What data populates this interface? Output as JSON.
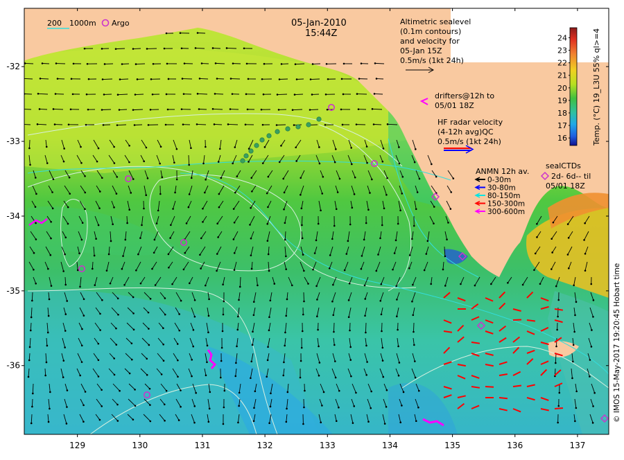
{
  "map": {
    "date": "05-Jan-2010",
    "time": "15:44Z",
    "scale_labels": [
      "200",
      "1000m"
    ],
    "argo_label": "Argo",
    "altimetric_lines": [
      "Altimetric sealevel",
      "(0.1m contours)",
      "and velocity for",
      "05-Jan 15Z",
      "0.5m/s (1kt 24h)"
    ],
    "drifters_lines": [
      "drifters@12h to",
      "05/01 18Z"
    ],
    "hf_lines": [
      "HF radar velocity",
      "(4-12h avg)QC",
      "0.5m/s (1kt 24h)"
    ],
    "anmn_title": "ANMN 12h av.",
    "anmn_items": [
      {
        "label": "0-30m",
        "color": "#000000"
      },
      {
        "label": "30-80m",
        "color": "#0000ff"
      },
      {
        "label": "80-150m",
        "color": "#00e5e5"
      },
      {
        "label": "150-300m",
        "color": "#ff0000"
      },
      {
        "label": "300-600m",
        "color": "#ff00ff"
      }
    ],
    "seal_lines": [
      "sealCTDs",
      "2d- 6d-- til",
      "05/01 18Z"
    ],
    "colorbar": {
      "label": "Temp. (°C) 19_L3U 55% ql>=4",
      "ticks": [
        16,
        17,
        18,
        19,
        20,
        21,
        22,
        23,
        24
      ],
      "range": [
        15.4,
        24.8
      ]
    },
    "credit": "© IMOS 15-May-2017 19:20:45 Hobart time",
    "x_axis": {
      "ticks": [
        129,
        130,
        131,
        132,
        133,
        134,
        135,
        136,
        137
      ],
      "range": [
        128.15,
        137.5
      ]
    },
    "y_axis": {
      "ticks": [
        -32,
        -33,
        -34,
        -35,
        -36
      ],
      "range": [
        -36.92,
        -31.22
      ]
    },
    "colors": {
      "land": "#f9c9a0",
      "contour": "#d8f0e0",
      "cyan_contour": "#33dddd",
      "argo": "#cc33cc",
      "drifter": "#ff00ff",
      "hf": "#ff0000",
      "white": "#ffffff"
    }
  }
}
